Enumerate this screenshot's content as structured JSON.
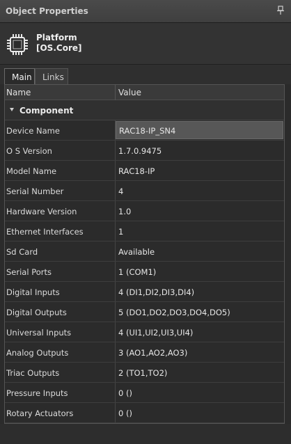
{
  "panel": {
    "title": "Object Properties"
  },
  "object": {
    "name": "Platform",
    "type": "[OS.Core]"
  },
  "tabs": [
    {
      "label": "Main",
      "active": true
    },
    {
      "label": "Links",
      "active": false
    }
  ],
  "grid": {
    "columns": [
      "Name",
      "Value"
    ],
    "group": "Component",
    "rows": [
      {
        "name": "Device Name",
        "value": "RAC18-IP_SN4"
      },
      {
        "name": "O S Version",
        "value": "1.7.0.9475"
      },
      {
        "name": "Model Name",
        "value": "RAC18-IP"
      },
      {
        "name": "Serial Number",
        "value": "4"
      },
      {
        "name": "Hardware Version",
        "value": "1.0"
      },
      {
        "name": "Ethernet Interfaces",
        "value": "1"
      },
      {
        "name": "Sd Card",
        "value": "Available"
      },
      {
        "name": "Serial Ports",
        "value": "1 (COM1)"
      },
      {
        "name": "Digital Inputs",
        "value": "4 (DI1,DI2,DI3,DI4)"
      },
      {
        "name": "Digital Outputs",
        "value": "5 (DO1,DO2,DO3,DO4,DO5)"
      },
      {
        "name": "Universal Inputs",
        "value": "4 (UI1,UI2,UI3,UI4)"
      },
      {
        "name": "Analog Outputs",
        "value": "3 (AO1,AO2,AO3)"
      },
      {
        "name": "Triac Outputs",
        "value": "2 (TO1,TO2)"
      },
      {
        "name": "Pressure Inputs",
        "value": "0 ()"
      },
      {
        "name": "Rotary Actuators",
        "value": "0 ()"
      }
    ]
  },
  "icons": {
    "pin": "pin-icon",
    "object": "chip-icon",
    "group": "collapse-arrow-icon"
  }
}
